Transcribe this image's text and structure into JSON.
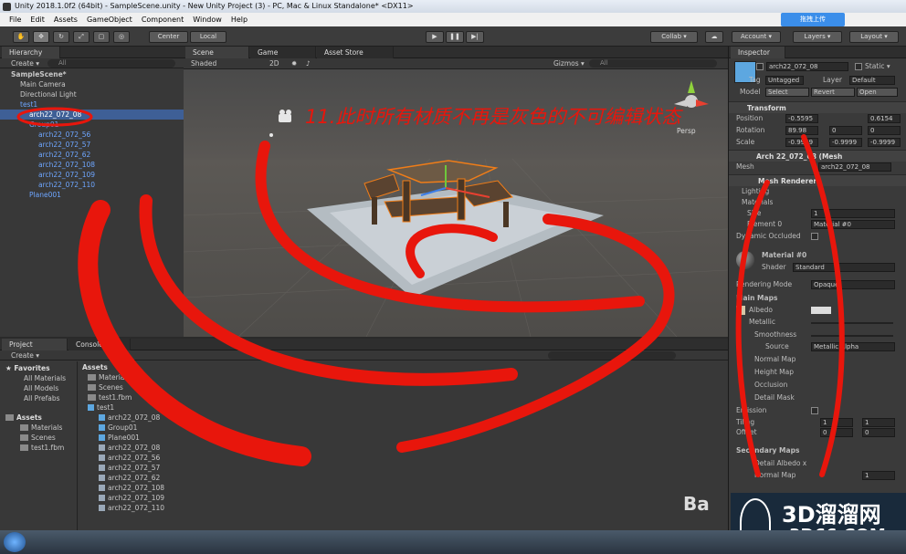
{
  "window": {
    "title": "Unity 2018.1.0f2 (64bit) - SampleScene.unity - New Unity Project (3) - PC, Mac & Linux Standalone* <DX11>"
  },
  "menu": [
    "File",
    "Edit",
    "Assets",
    "GameObject",
    "Component",
    "Window",
    "Help"
  ],
  "baidu_upload": "拖拽上传",
  "toolbar": {
    "center": "Center",
    "local": "Local",
    "collab": "Collab ▾",
    "account": "Account ▾",
    "layers": "Layers ▾",
    "layout": "Layout ▾"
  },
  "hierarchy": {
    "tab": "Hierarchy",
    "create": "Create ▾",
    "search": "All",
    "items": [
      {
        "label": "SampleScene*",
        "depth": 0
      },
      {
        "label": "Main Camera",
        "depth": 1
      },
      {
        "label": "Directional Light",
        "depth": 1
      },
      {
        "label": "test1",
        "depth": 1
      },
      {
        "label": "arch22_072_08",
        "depth": 2
      },
      {
        "label": "Group01",
        "depth": 2
      },
      {
        "label": "arch22_072_56",
        "depth": 3
      },
      {
        "label": "arch22_072_57",
        "depth": 3
      },
      {
        "label": "arch22_072_62",
        "depth": 3
      },
      {
        "label": "arch22_072_108",
        "depth": 3
      },
      {
        "label": "arch22_072_109",
        "depth": 3
      },
      {
        "label": "arch22_072_110",
        "depth": 3
      },
      {
        "label": "Plane001",
        "depth": 2
      }
    ]
  },
  "scene": {
    "tabs": [
      "Scene",
      "Game",
      "Asset Store"
    ],
    "shaded": "Shaded",
    "mode2d": "2D",
    "gizmos": "Gizmos ▾",
    "search": "All",
    "persp": "Persp",
    "annotation": "11.此时所有材质不再是灰色的不可编辑状态"
  },
  "project": {
    "tabs": [
      "Project",
      "Console"
    ],
    "create": "Create ▾",
    "favorites_title": "Favorites",
    "favorites": [
      "All Materials",
      "All Models",
      "All Prefabs"
    ],
    "assets_title": "Assets",
    "assets_tree": [
      "Materials",
      "Scenes",
      "test1.fbm"
    ],
    "breadcrumb": "Assets",
    "files": [
      {
        "label": "Materials",
        "kind": "folder",
        "indent": 0
      },
      {
        "label": "Scenes",
        "kind": "folder",
        "indent": 0
      },
      {
        "label": "test1.fbm",
        "kind": "folder",
        "indent": 0
      },
      {
        "label": "test1",
        "kind": "model",
        "indent": 0
      },
      {
        "label": "arch22_072_08",
        "kind": "mesh",
        "indent": 1
      },
      {
        "label": "Group01",
        "kind": "mesh",
        "indent": 1
      },
      {
        "label": "Plane001",
        "kind": "mesh",
        "indent": 1
      },
      {
        "label": "arch22_072_08",
        "kind": "grid",
        "indent": 1
      },
      {
        "label": "arch22_072_56",
        "kind": "grid",
        "indent": 1
      },
      {
        "label": "arch22_072_57",
        "kind": "grid",
        "indent": 1
      },
      {
        "label": "arch22_072_62",
        "kind": "grid",
        "indent": 1
      },
      {
        "label": "arch22_072_108",
        "kind": "grid",
        "indent": 1
      },
      {
        "label": "arch22_072_109",
        "kind": "grid",
        "indent": 1
      },
      {
        "label": "arch22_072_110",
        "kind": "grid",
        "indent": 1
      }
    ]
  },
  "inspector": {
    "tab": "Inspector",
    "object_name": "arch22_072_08",
    "static": "Static ▾",
    "tag_label": "Tag",
    "tag_value": "Untagged",
    "layer_label": "Layer",
    "layer_value": "Default",
    "model_label": "Model",
    "select": "Select",
    "revert": "Revert",
    "open": "Open",
    "transform": "Transform",
    "position": "Position",
    "pos_x": "-0.5595",
    "pos_z": "0.6154",
    "rotation": "Rotation",
    "rot_x": "89.98",
    "rot_y": "0",
    "rot_z": "0",
    "scale": "Scale",
    "scale_x": "-0.9999",
    "scale_y": "-0.9999",
    "scale_z": "-0.9999",
    "mesh_filter": "Arch 22_072_08 (Mesh",
    "mesh_label": "Mesh",
    "mesh_value": "arch22_072_08",
    "mesh_renderer": "Mesh Renderer",
    "lighting": "Lighting",
    "materials": "Materials",
    "size": "Size",
    "size_value": "1",
    "element0": "Element 0",
    "element0_value": "Material #0",
    "dynamic_occluded": "Dynamic Occluded",
    "material_name": "Material #0",
    "shader_label": "Shader",
    "shader_value": "Standard",
    "rendering_mode": "Rendering Mode",
    "rendering_mode_value": "Opaque",
    "main_maps": "Main Maps",
    "albedo": "Albedo",
    "metallic": "Metallic",
    "smoothness": "Smoothness",
    "source": "Source",
    "source_value": "Metallic Alpha",
    "normal_map": "Normal Map",
    "height_map": "Height Map",
    "occlusion": "Occlusion",
    "detail_mask": "Detail Mask",
    "emission": "Emission",
    "tiling": "Tiling",
    "tiling_x": "1",
    "tiling_y": "1",
    "offset": "Offset",
    "offset_x": "0",
    "offset_y": "0",
    "secondary_maps": "Secondary Maps",
    "detail_albedo": "Detail Albedo x",
    "normal_map2": "Normal Map",
    "normal_map2_value": "1"
  },
  "watermark": {
    "brand": "3D溜溜网",
    "url": "3D66.COM"
  },
  "colors": {
    "selection": "#3e5f96",
    "blue_text": "#6ea6ff",
    "annotation_red": "#e8160c",
    "orange_outline": "#f07d18"
  }
}
